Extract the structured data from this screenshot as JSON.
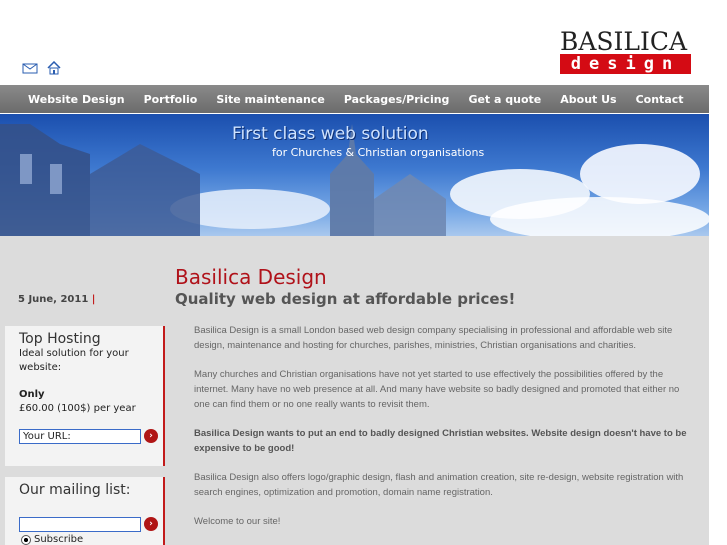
{
  "header": {
    "icons": [
      "mail-icon",
      "home-icon"
    ],
    "logo": {
      "top_text": "BASILICA",
      "bar_text": "design",
      "bar_color": "#d40b14"
    }
  },
  "nav": {
    "items": [
      {
        "label": "Website Design"
      },
      {
        "label": "Portfolio"
      },
      {
        "label": "Site maintenance"
      },
      {
        "label": "Packages/Pricing"
      },
      {
        "label": "Get a quote"
      },
      {
        "label": "About Us"
      },
      {
        "label": "Contact"
      }
    ]
  },
  "banner": {
    "line1": "First class web solution",
    "line2": "for Churches & Christian organisations"
  },
  "date": {
    "text": "5 June, 2011",
    "sep": "|"
  },
  "main": {
    "title": "Basilica Design",
    "subtitle": "Quality web design at affordable prices!",
    "paragraphs": [
      "Basilica Design is a small London based web design company specialising in professional and affordable web site design, maintenance and hosting for churches, parishes, ministries, Christian organisations and charities.",
      "Many churches and Christian organisations have not yet started to use effectively the possibilities offered by the internet. Many have no web presence at all. And many have website so badly designed and promoted that either no one can find them or no one really wants to revisit them.",
      "Basilica Design wants to put an end to badly designed Christian websites. Website design doesn't have to be expensive to be good!",
      "Basilica Design also offers logo/graphic design, flash and animation creation, site re-design, website registration with search engines, optimization and promotion, domain name registration.",
      "Welcome to our site!"
    ]
  },
  "hosting": {
    "title": "Top Hosting",
    "desc": "Ideal solution for your website:",
    "only": "Only",
    "price": "£60.00 (100$) per year",
    "url_value": "Your URL:",
    "go": "›"
  },
  "mailing": {
    "title": "Our mailing list:",
    "email_value": "",
    "go": "›",
    "option": "Subscribe"
  },
  "colors": {
    "accent": "#b0121a",
    "nav_bg": "#777777",
    "panel_bg": "#dcdcdc"
  }
}
